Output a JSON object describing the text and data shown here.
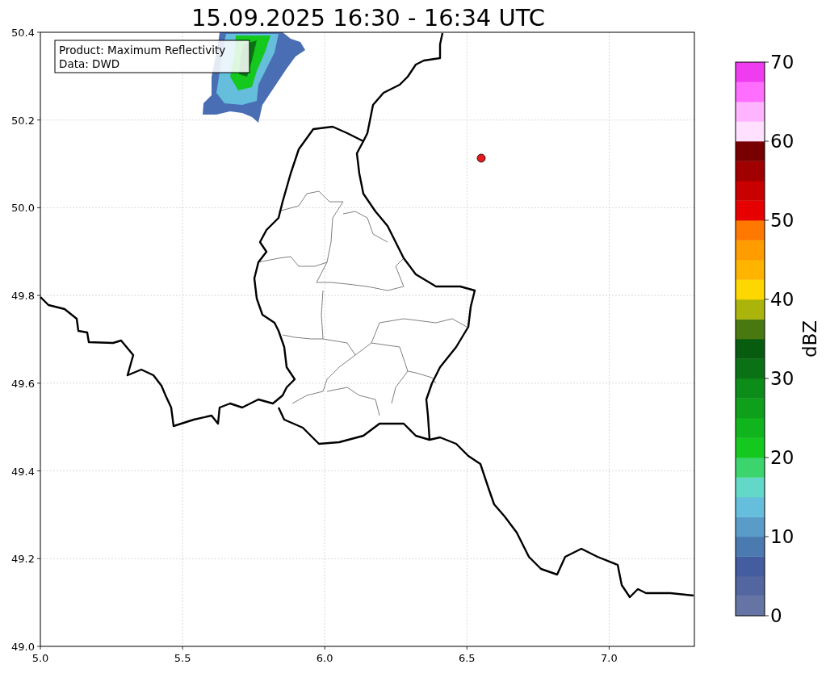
{
  "title": "15.09.2025 16:30 - 16:34 UTC",
  "info_box": [
    "Product: Maximum Reflectivity",
    "Data: DWD"
  ],
  "map": {
    "xticks": [
      "5.0",
      "5.5",
      "6.0",
      "6.5",
      "7.0"
    ],
    "yticks": [
      "50.4",
      "50.2",
      "50.0",
      "49.8",
      "49.6",
      "49.4",
      "49.2",
      "49.0"
    ]
  },
  "colorbar": {
    "label": "dBZ",
    "ticks": [
      "70",
      "60",
      "50",
      "40",
      "30",
      "20",
      "10",
      "0"
    ],
    "bands": [
      {
        "color": "#6474a4"
      },
      {
        "color": "#5466a0"
      },
      {
        "color": "#445ca0"
      },
      {
        "color": "#4a7ab0"
      },
      {
        "color": "#5a9cc8"
      },
      {
        "color": "#64bedc"
      },
      {
        "color": "#64d8c8"
      },
      {
        "color": "#3cd46c"
      },
      {
        "color": "#14c81e"
      },
      {
        "color": "#10b41c"
      },
      {
        "color": "#0ea01a"
      },
      {
        "color": "#0c8c18"
      },
      {
        "color": "#0a7214"
      },
      {
        "color": "#085c10"
      },
      {
        "color": "#4a7810"
      },
      {
        "color": "#aab40a"
      },
      {
        "color": "#ffd700"
      },
      {
        "color": "#ffb400"
      },
      {
        "color": "#ff9c00"
      },
      {
        "color": "#ff7800"
      },
      {
        "color": "#e60000"
      },
      {
        "color": "#c80000"
      },
      {
        "color": "#a00000"
      },
      {
        "color": "#780000"
      },
      {
        "color": "#ffe0ff"
      },
      {
        "color": "#ffb4ff"
      },
      {
        "color": "#ff6eff"
      },
      {
        "color": "#f03cf0"
      }
    ]
  }
}
